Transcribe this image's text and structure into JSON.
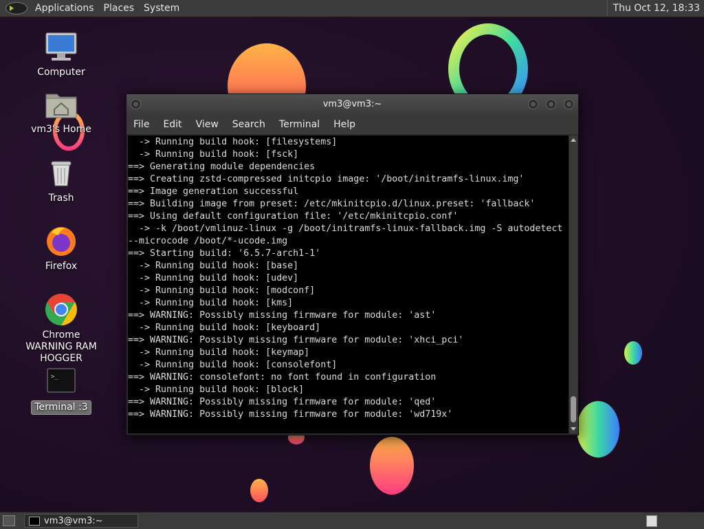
{
  "top_panel": {
    "menu_applications": "Applications",
    "menu_places": "Places",
    "menu_system": "System",
    "clock": "Thu Oct 12, 18:33"
  },
  "desktop_icons": {
    "computer": "Computer",
    "home": "vm3's Home",
    "trash": "Trash",
    "firefox": "Firefox",
    "chrome": "Chrome WARNING RAM HOGGER",
    "terminal": "Terminal :3"
  },
  "terminal": {
    "title": "vm3@vm3:~",
    "menu": [
      "File",
      "Edit",
      "View",
      "Search",
      "Terminal",
      "Help"
    ],
    "output": "  -> Running build hook: [filesystems]\n  -> Running build hook: [fsck]\n==> Generating module dependencies\n==> Creating zstd-compressed initcpio image: '/boot/initramfs-linux.img'\n==> Image generation successful\n==> Building image from preset: /etc/mkinitcpio.d/linux.preset: 'fallback'\n==> Using default configuration file: '/etc/mkinitcpio.conf'\n  -> -k /boot/vmlinuz-linux -g /boot/initramfs-linux-fallback.img -S autodetect\n--microcode /boot/*-ucode.img\n==> Starting build: '6.5.7-arch1-1'\n  -> Running build hook: [base]\n  -> Running build hook: [udev]\n  -> Running build hook: [modconf]\n  -> Running build hook: [kms]\n==> WARNING: Possibly missing firmware for module: 'ast'\n  -> Running build hook: [keyboard]\n==> WARNING: Possibly missing firmware for module: 'xhci_pci'\n  -> Running build hook: [keymap]\n  -> Running build hook: [consolefont]\n==> WARNING: consolefont: no font found in configuration\n  -> Running build hook: [block]\n==> WARNING: Possibly missing firmware for module: 'qed'\n==> WARNING: Possibly missing firmware for module: 'wd719x'"
  },
  "bottom_panel": {
    "task_label": "vm3@vm3:~"
  },
  "colors": {
    "panel": "#3b3b3b",
    "desktop": "#1e0d24",
    "terminal_bg": "#000000",
    "terminal_fg": "#dcdcdc"
  }
}
